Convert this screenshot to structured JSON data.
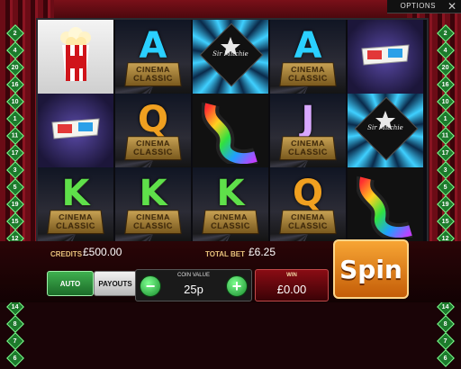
{
  "topbar": {
    "options_label": "OPTIONS",
    "close_glyph": "✕"
  },
  "paylines": {
    "left": [
      "2",
      "4",
      "20",
      "16",
      "10",
      "1",
      "11",
      "17",
      "3",
      "5",
      "19",
      "15",
      "12",
      "18",
      "9",
      "13",
      "14",
      "8",
      "7",
      "6"
    ],
    "right": [
      "2",
      "4",
      "20",
      "16",
      "10",
      "1",
      "11",
      "17",
      "3",
      "5",
      "19",
      "15",
      "12",
      "18",
      "9",
      "13",
      "14",
      "8",
      "7",
      "6"
    ]
  },
  "reels": [
    [
      "popcorn",
      "glasses",
      "K"
    ],
    [
      "A",
      "Q",
      "K"
    ],
    [
      "star",
      "film",
      "K"
    ],
    [
      "A",
      "J",
      "Q"
    ],
    [
      "glasses",
      "star",
      "film"
    ]
  ],
  "symbols": {
    "plinth_line1": "CINEMA",
    "plinth_line2": "CLASSIC",
    "star_text": "Sir Mitchie",
    "popcorn_text": "Pop Corn"
  },
  "bottom": {
    "credits_label": "CREDITS",
    "credits_value": "£500.00",
    "total_bet_label": "TOTAL BET",
    "total_bet_value": "£6.25",
    "auto_label": "AUTO",
    "payouts_label": "PAYOUTS",
    "coin_value_label": "COIN VALUE",
    "coin_value": "25p",
    "minus_glyph": "−",
    "plus_glyph": "+",
    "win_label": "WIN",
    "win_value": "£0.00",
    "spin_label": "Spin"
  },
  "colors": {
    "letter_A": "#2ad0ff",
    "letter_K": "#5fe04a",
    "letter_Q": "#f0a020",
    "letter_J": "#d8a8ff",
    "spin": "#f08a20"
  }
}
